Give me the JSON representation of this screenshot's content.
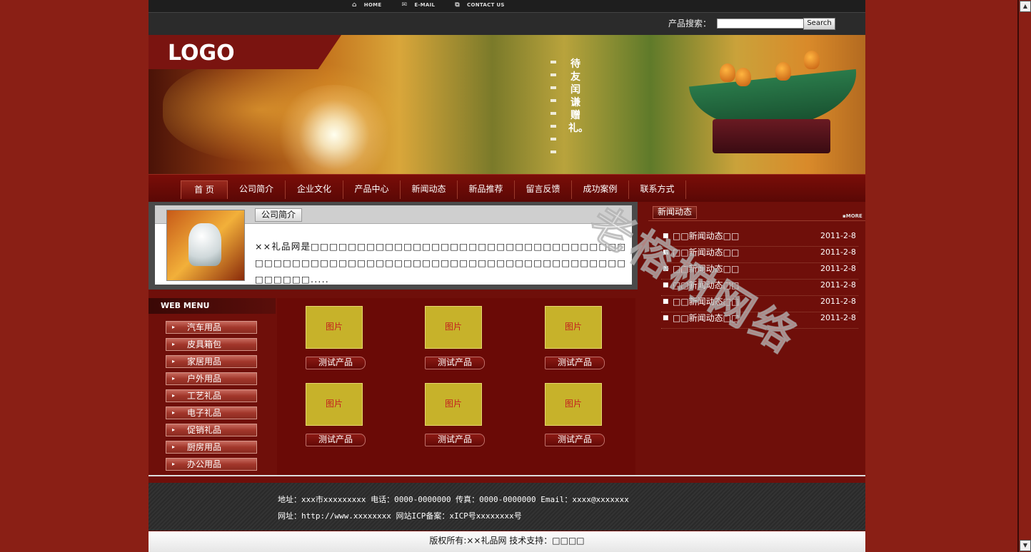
{
  "toplinks": [
    {
      "icon": "home-icon",
      "label": "HOME"
    },
    {
      "icon": "mail-icon",
      "label": "E-MAIL"
    },
    {
      "icon": "contact-icon",
      "label": "CONTACT US"
    }
  ],
  "search": {
    "label": "产品搜索：",
    "value": "",
    "button": "Search"
  },
  "banner": {
    "logo": "LOGO",
    "slogan": "待友闰谦赠礼。"
  },
  "nav": [
    "首 页",
    "公司简介",
    "企业文化",
    "产品中心",
    "新闻动态",
    "新品推荐",
    "留言反馈",
    "成功案例",
    "联系方式"
  ],
  "about": {
    "title": "公司简介",
    "text": "××礼品网是□□□□□□□□□□□□□□□□□□□□□□□□□□□□□□□□□□□□□□□□□□□□□□□□□□□□□□□□□□□□□□□□□□□□□□□□□□□□□□□□....."
  },
  "webmenu": {
    "title": "WEB MENU",
    "items": [
      "汽车用品",
      "皮具箱包",
      "家居用品",
      "户外用品",
      "工艺礼品",
      "电子礼品",
      "促销礼品",
      "厨房用品",
      "办公用品"
    ]
  },
  "products": [
    {
      "img": "图片",
      "name": "测试产品"
    },
    {
      "img": "图片",
      "name": "测试产品"
    },
    {
      "img": "图片",
      "name": "测试产品"
    },
    {
      "img": "图片",
      "name": "测试产品"
    },
    {
      "img": "图片",
      "name": "测试产品"
    },
    {
      "img": "图片",
      "name": "测试产品"
    }
  ],
  "news": {
    "title": "新闻动态",
    "more": "MORE",
    "items": [
      {
        "title": "□□新闻动态□□",
        "date": "2011-2-8"
      },
      {
        "title": "□□新闻动态□□",
        "date": "2011-2-8"
      },
      {
        "title": "□□新闻动态□□",
        "date": "2011-2-8"
      },
      {
        "title": "□□新闻动态□□",
        "date": "2011-2-8"
      },
      {
        "title": "□□新闻动态□□",
        "date": "2011-2-8"
      },
      {
        "title": "□□新闻动态□□",
        "date": "2011-2-8"
      }
    ]
  },
  "footer": {
    "line1": "地址：xxx市xxxxxxxxx 电话：0000-0000000 传真：0000-0000000 Email：xxxx@xxxxxxx",
    "line2": "网址：http://www.xxxxxxxx 网站ICP备案：xICP号xxxxxxxx号",
    "copyright": "版权所有:××礼品网 技术支持：□□□□"
  },
  "watermark": "老榕树网络"
}
